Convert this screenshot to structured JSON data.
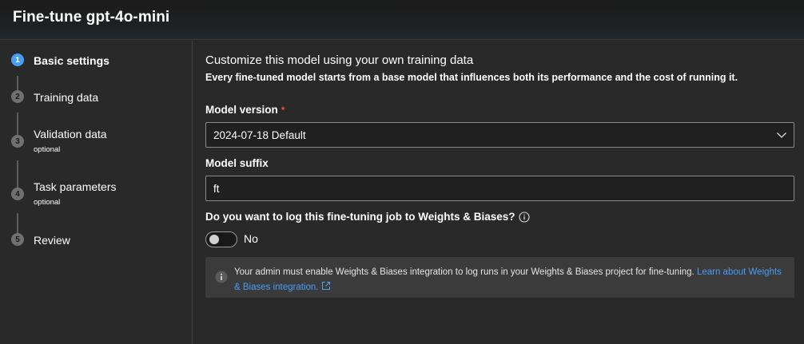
{
  "window": {
    "title": "Fine-tune gpt-4o-mini"
  },
  "steps": [
    {
      "number": "1",
      "label": "Basic settings",
      "sublabel": "",
      "active": true
    },
    {
      "number": "2",
      "label": "Training data",
      "sublabel": "",
      "active": false
    },
    {
      "number": "3",
      "label": "Validation data",
      "sublabel": "optional",
      "active": false
    },
    {
      "number": "4",
      "label": "Task parameters",
      "sublabel": "optional",
      "active": false
    },
    {
      "number": "5",
      "label": "Review",
      "sublabel": "",
      "active": false
    }
  ],
  "main": {
    "heading": "Customize this model using your own training data",
    "subheading": "Every fine-tuned model starts from a base model that influences both its performance and the cost of running it.",
    "model_version": {
      "label": "Model version",
      "required_marker": "*",
      "value": "2024-07-18 Default"
    },
    "model_suffix": {
      "label": "Model suffix",
      "value": "ft"
    },
    "wandb": {
      "question": "Do you want to log this fine-tuning job to Weights & Biases?",
      "toggle_state": "No"
    },
    "banner": {
      "text": "Your admin must enable Weights & Biases integration to log runs in your Weights & Biases project for fine-tuning.",
      "link_text": "Learn about Weights & Biases integration."
    }
  },
  "colors": {
    "background": "#292929",
    "accent": "#479ef5",
    "required": "#e74856",
    "banner": "#3b3b3b"
  },
  "icons": [
    "chevron-down-icon",
    "info-icon",
    "external-link-icon"
  ]
}
